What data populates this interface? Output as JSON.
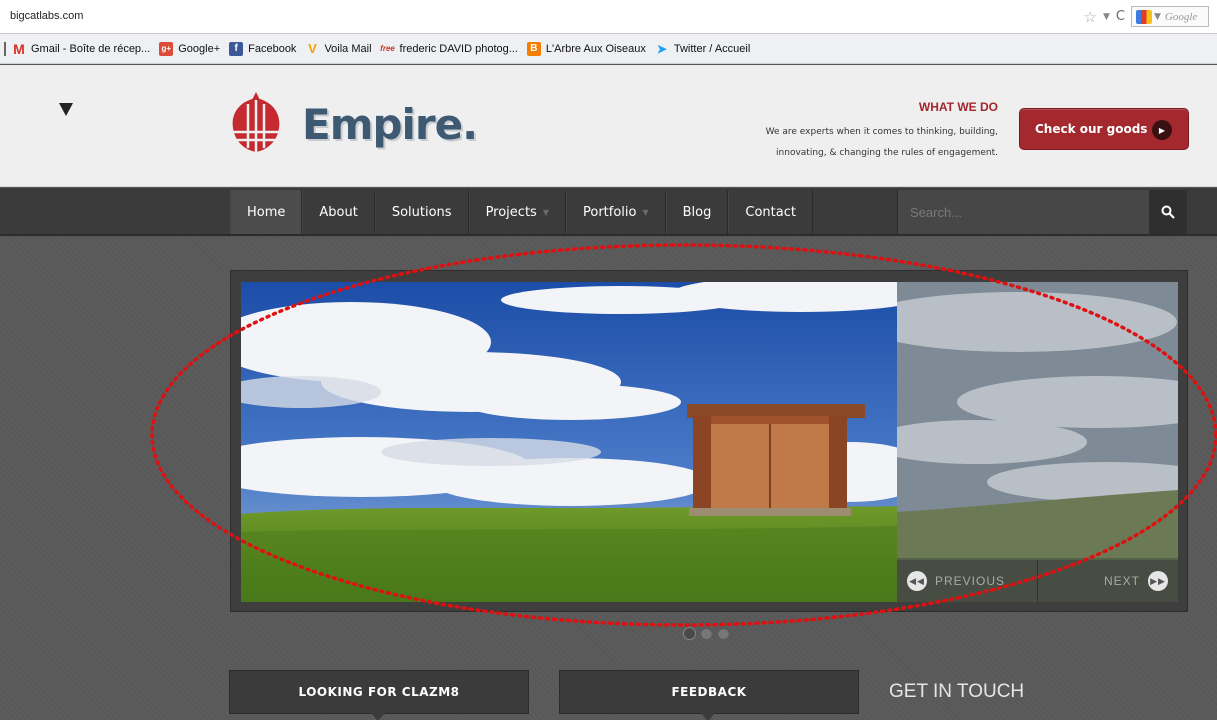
{
  "browser": {
    "url": "bigcatlabs.com",
    "search_engine": "Google",
    "bookmarks": [
      {
        "label": "Gmail - Boîte de récep...",
        "icon": "gmail-icon",
        "color": "#d93025"
      },
      {
        "label": "Google+",
        "icon": "google-plus-icon",
        "color": "#dd4b39"
      },
      {
        "label": "Facebook",
        "icon": "facebook-icon",
        "color": "#3b5998"
      },
      {
        "label": "Voila Mail",
        "icon": "voila-icon",
        "color": "#f0a000"
      },
      {
        "label": "frederic DAVID photog...",
        "icon": "free-icon",
        "color": "#c0392b"
      },
      {
        "label": "L'Arbre Aux Oiseaux",
        "icon": "blogger-icon",
        "color": "#f57d00"
      },
      {
        "label": "Twitter / Accueil",
        "icon": "twitter-icon",
        "color": "#1da1f2"
      }
    ]
  },
  "header": {
    "logo_text": "Empire.",
    "whatwedo_title": "WHAT WE DO",
    "whatwedo_line1": "We are experts when it comes to thinking, building,",
    "whatwedo_line2": "innovating, & changing the rules of engagement.",
    "cta_label": "Check our goods"
  },
  "nav": {
    "items": [
      "Home",
      "About",
      "Solutions",
      "Projects",
      "Portfolio",
      "Blog",
      "Contact"
    ],
    "search_placeholder": "Search..."
  },
  "slider": {
    "prev_label": "PREVIOUS",
    "next_label": "NEXT",
    "slide_count": 3,
    "active_slide": 1
  },
  "sections": {
    "panel1": "LOOKING FOR CLAZM8",
    "panel2": "FEEDBACK",
    "contact_heading": "GET IN TOUCH"
  },
  "colors": {
    "brand_red": "#a3292f",
    "logo_blue": "#3e5a73",
    "nav_bg": "#3b3b3b",
    "annotation_red": "#e01010"
  }
}
